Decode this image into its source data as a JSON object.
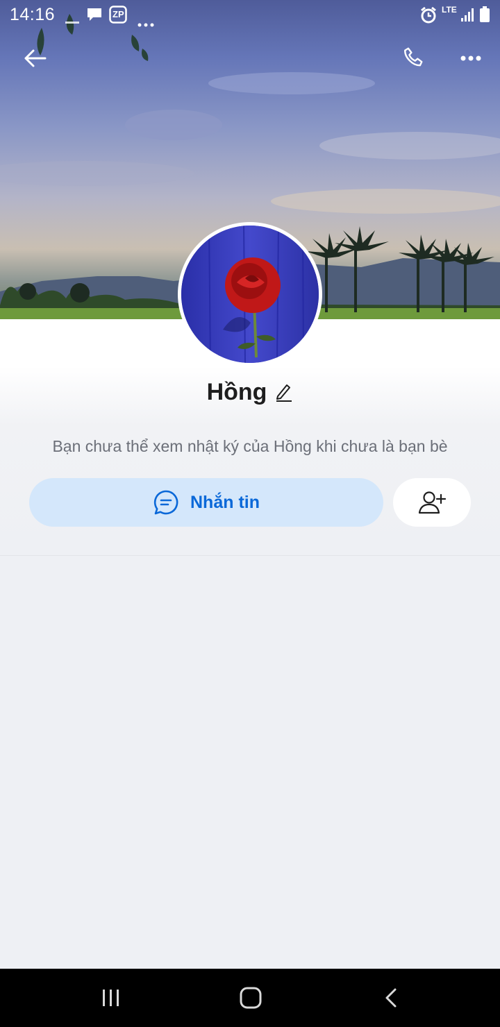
{
  "status_bar": {
    "time": "14:16",
    "network": "LTE",
    "icons": [
      "ereader-icon",
      "message-icon",
      "zp-icon",
      "more-dots-icon",
      "alarm-icon",
      "signal-icon",
      "battery-icon"
    ],
    "zp_label": "ZP"
  },
  "top_bar": {
    "icons": [
      "back-arrow-icon",
      "phone-icon",
      "more-icon"
    ]
  },
  "profile": {
    "name": "Hồng",
    "notice": "Bạn chưa thể xem nhật ký của Hồng khi chưa là bạn bè"
  },
  "actions": {
    "message_label": "Nhắn tin",
    "message_icon": "chat-bubble-icon",
    "add_friend_icon": "add-friend-icon"
  },
  "nav_bar": {
    "icons": [
      "recents-icon",
      "home-icon",
      "back-icon"
    ]
  },
  "colors": {
    "accent": "#0a68d8",
    "accent_bg": "#d4e7fb",
    "page_bg": "#eef0f4"
  }
}
